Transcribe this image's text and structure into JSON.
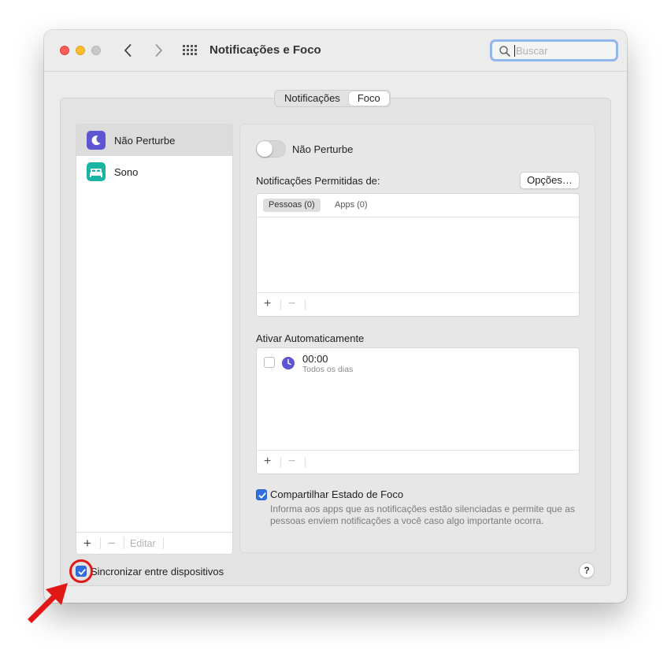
{
  "window": {
    "title": "Notificações e Foco"
  },
  "search": {
    "placeholder": "Buscar",
    "value": ""
  },
  "tabs": [
    {
      "label": "Notificações",
      "selected": false
    },
    {
      "label": "Foco",
      "selected": true
    }
  ],
  "sidebar": {
    "items": [
      {
        "label": "Não Perturbe",
        "icon": "moon-icon",
        "color": "#5e55d3",
        "selected": true
      },
      {
        "label": "Sono",
        "icon": "bed-icon",
        "color": "#19b4a3",
        "selected": false
      }
    ],
    "footer": {
      "add": "+",
      "remove": "−",
      "edit": "Editar"
    }
  },
  "detail": {
    "toggle_label": "Não Perturbe",
    "toggle_on": false,
    "allowed_label": "Notificações Permitidas de:",
    "options_button": "Opções…",
    "allowed_tabs": [
      {
        "label": "Pessoas (0)",
        "selected": true
      },
      {
        "label": "Apps (0)",
        "selected": false
      }
    ],
    "list_add": "+",
    "list_remove": "−",
    "auto_label": "Ativar Automaticamente",
    "schedules": [
      {
        "checked": false,
        "time": "00:00",
        "subtitle": "Todos os dias",
        "icon": "clock-icon"
      }
    ],
    "share": {
      "checked": true,
      "label": "Compartilhar Estado de Foco",
      "description": "Informa aos apps que as notificações estão silenciadas e permite que as pessoas enviem notificações a você caso algo importante ocorra."
    }
  },
  "bottom": {
    "sync_checked": true,
    "sync_label": "Sincronizar entre dispositivos",
    "help": "?"
  },
  "colors": {
    "accent": "#2f6fe0",
    "annotation": "#e01818"
  }
}
